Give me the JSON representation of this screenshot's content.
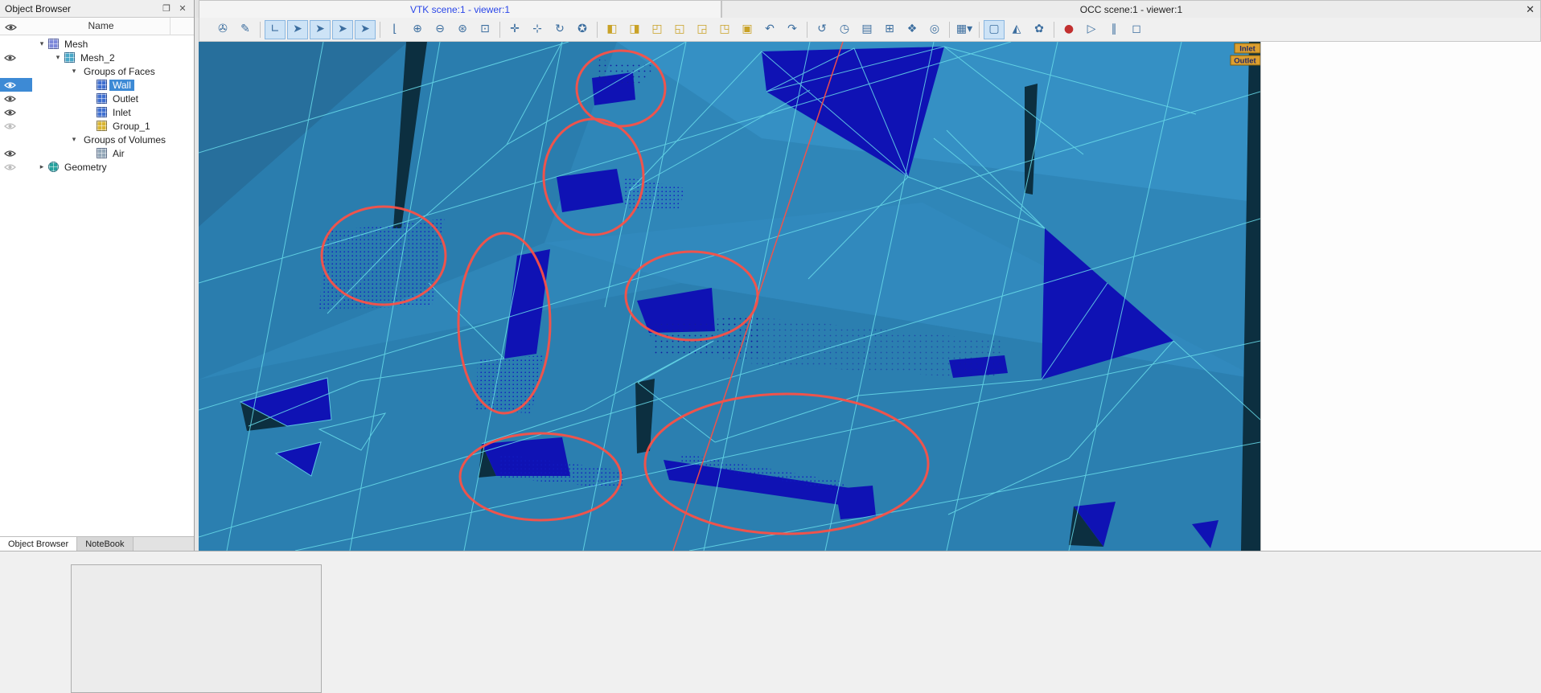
{
  "object_browser": {
    "title": "Object Browser",
    "float_glyph": "❐",
    "close_glyph": "✕",
    "column_header": "Name",
    "tree": [
      {
        "label": "Mesh",
        "level": 1,
        "expander": "open",
        "icon": "mesh-root",
        "eye": null,
        "selected": false
      },
      {
        "label": "Mesh_2",
        "level": 2,
        "expander": "open",
        "icon": "mesh",
        "eye": "on",
        "selected": false
      },
      {
        "label": "Groups of Faces",
        "level": 3,
        "expander": "open",
        "icon": null,
        "eye": null,
        "selected": false
      },
      {
        "label": "Wall",
        "level": 4,
        "expander": null,
        "icon": "facegroup",
        "eye": "on",
        "selected": true
      },
      {
        "label": "Outlet",
        "level": 4,
        "expander": null,
        "icon": "facegroup",
        "eye": "on",
        "selected": false
      },
      {
        "label": "Inlet",
        "level": 4,
        "expander": null,
        "icon": "facegroup",
        "eye": "on",
        "selected": false
      },
      {
        "label": "Group_1",
        "level": 4,
        "expander": null,
        "icon": "group1",
        "eye": "dim",
        "selected": false
      },
      {
        "label": "Groups of Volumes",
        "level": 3,
        "expander": "open",
        "icon": null,
        "eye": null,
        "selected": false
      },
      {
        "label": "Air",
        "level": 4,
        "expander": null,
        "icon": "volgroup",
        "eye": "on",
        "selected": false
      },
      {
        "label": "Geometry",
        "level": 1,
        "expander": "closed",
        "icon": "geom",
        "eye": "dim",
        "selected": false
      }
    ],
    "tabs": [
      {
        "label": "Object Browser",
        "active": true
      },
      {
        "label": "NoteBook",
        "active": false
      }
    ]
  },
  "viewers": {
    "vtk_tab": "VTK scene:1 - viewer:1",
    "occ_tab": "OCC scene:1 - viewer:1",
    "close_glyph": "✕"
  },
  "toolbar": {
    "buttons": [
      {
        "name": "dump-view-button",
        "glyph": "✇"
      },
      {
        "name": "interaction-style-button",
        "glyph": "✎"
      },
      {
        "name": "show-trihedron-button",
        "glyph": "∟",
        "pressed": true,
        "sep_before": true
      },
      {
        "name": "preselection-button",
        "glyph": "➤",
        "pressed": true
      },
      {
        "name": "selection-point-button",
        "glyph": "➤",
        "pressed": true
      },
      {
        "name": "selection-edge-button",
        "glyph": "➤",
        "pressed": true
      },
      {
        "name": "selection-face-button",
        "glyph": "➤",
        "pressed": true
      },
      {
        "name": "view-axes-button",
        "glyph": "⌊",
        "sep_before": true
      },
      {
        "name": "zoom-in-button",
        "glyph": "⊕"
      },
      {
        "name": "zoom-out-button",
        "glyph": "⊖"
      },
      {
        "name": "fit-all-button",
        "glyph": "⊛"
      },
      {
        "name": "fit-area-button",
        "glyph": "⊡"
      },
      {
        "name": "panning-button",
        "glyph": "✛",
        "sep_before": true
      },
      {
        "name": "global-panning-button",
        "glyph": "⊹"
      },
      {
        "name": "rotation-button",
        "glyph": "↻"
      },
      {
        "name": "change-rotation-point-button",
        "glyph": "✪"
      },
      {
        "name": "front-view-button",
        "glyph": "◧",
        "gold": true,
        "sep_before": true
      },
      {
        "name": "back-view-button",
        "glyph": "◨",
        "gold": true
      },
      {
        "name": "top-view-button",
        "glyph": "◰",
        "gold": true
      },
      {
        "name": "bottom-view-button",
        "glyph": "◱",
        "gold": true
      },
      {
        "name": "left-view-button",
        "glyph": "◲",
        "gold": true
      },
      {
        "name": "right-view-button",
        "glyph": "◳",
        "gold": true
      },
      {
        "name": "isometric-view-button",
        "glyph": "▣",
        "gold": true
      },
      {
        "name": "rotate-ccw-button",
        "glyph": "↶"
      },
      {
        "name": "rotate-cw-button",
        "glyph": "↷"
      },
      {
        "name": "reset-view-button",
        "glyph": "↺",
        "sep_before": true
      },
      {
        "name": "update-rate-button",
        "glyph": "◷"
      },
      {
        "name": "scalar-bar-button",
        "glyph": "▤"
      },
      {
        "name": "graduated-axes-button",
        "glyph": "⊞"
      },
      {
        "name": "visual-parameters-button",
        "glyph": "❖"
      },
      {
        "name": "stereo-view-button",
        "glyph": "◎"
      },
      {
        "name": "selection-mode-dropdown",
        "glyph": "▦▾",
        "sep_before": true
      },
      {
        "name": "shading-mode-button",
        "glyph": "▢",
        "pressed": true,
        "sep_before": true
      },
      {
        "name": "shrink-mode-button",
        "glyph": "◭"
      },
      {
        "name": "coloring-button",
        "glyph": "✿"
      },
      {
        "name": "record-button",
        "glyph": "●",
        "color": "#c23030",
        "sep_before": true
      },
      {
        "name": "play-button",
        "glyph": "▷"
      },
      {
        "name": "pause-button",
        "glyph": "∥"
      },
      {
        "name": "stop-button",
        "glyph": "◻"
      }
    ]
  },
  "viewport": {
    "labels": [
      {
        "text": "Inlet"
      },
      {
        "text": "Outlet"
      }
    ],
    "background": "#2f86b8",
    "edge_color": "#69dcea",
    "feature_color": "#0f12b4",
    "annotation_color": "#ff5044",
    "label_bg": "#dd9f2e"
  },
  "colors": {
    "selection": "#3d8ad5"
  }
}
